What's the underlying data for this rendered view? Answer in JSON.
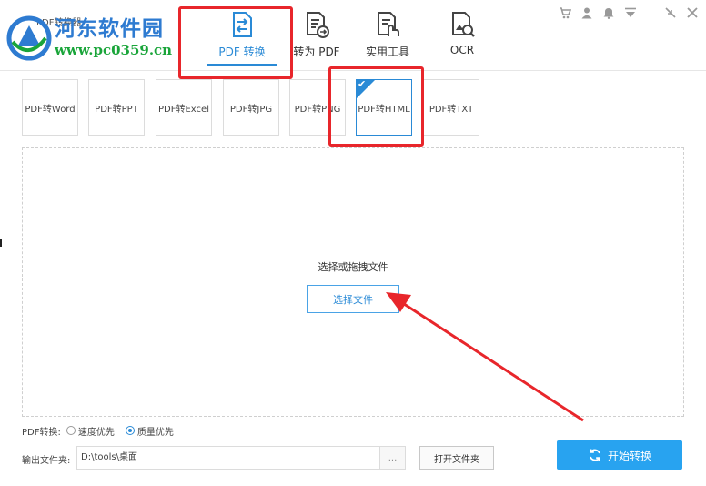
{
  "app": {
    "name": "PDF转换器"
  },
  "watermark": {
    "title": "河东软件园",
    "url": "www.pc0359.cn"
  },
  "nav": {
    "tabs": [
      {
        "label": "PDF 转换",
        "icon": "pdf-convert-icon",
        "active": true
      },
      {
        "label": "转为 PDF",
        "icon": "to-pdf-icon",
        "active": false
      },
      {
        "label": "实用工具",
        "icon": "tools-icon",
        "active": false
      },
      {
        "label": "OCR",
        "icon": "ocr-icon",
        "active": false
      }
    ]
  },
  "window_controls": [
    "cart-icon",
    "user-icon",
    "bell-icon",
    "dropdown-icon",
    "minimize-icon",
    "close-icon"
  ],
  "sub_tabs": [
    {
      "label": "PDF转Word"
    },
    {
      "label": "PDF转PPT"
    },
    {
      "label": "PDF转Excel"
    },
    {
      "label": "PDF转JPG"
    },
    {
      "label": "PDF转PNG"
    },
    {
      "label": "PDF转HTML",
      "selected": true
    },
    {
      "label": "PDF转TXT"
    }
  ],
  "drop": {
    "hint": "选择或拖拽文件",
    "button": "选择文件"
  },
  "mode": {
    "label": "PDF转换:",
    "options": [
      {
        "label": "速度优先",
        "checked": false
      },
      {
        "label": "质量优先",
        "checked": true
      }
    ]
  },
  "output": {
    "label": "输出文件夹:",
    "value": "D:\\tools\\桌面",
    "browse": "...",
    "open_folder": "打开文件夹"
  },
  "start": {
    "label": "开始转换"
  },
  "colors": {
    "accent": "#2a8ad6",
    "start_button": "#28a3f0",
    "annotation": "#e8262b",
    "watermark_blue": "#2e7bd1",
    "watermark_green": "#1aa53a"
  }
}
